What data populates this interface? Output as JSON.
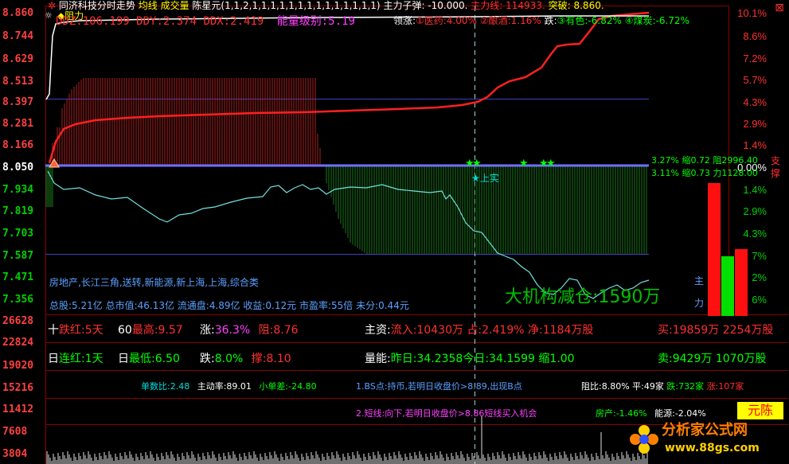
{
  "header": {
    "star": "✲",
    "title": "同济科技分时走势",
    "avg_line": "均线",
    "volume": "成交量",
    "formula": "陈星元(1,1,2,1,1,1,1,1,1,1,1,1,1,1,1,1,1)",
    "main_sub_label": "主力子弹:",
    "main_sub_value": "-10.000.",
    "main_line": "主力线:",
    "main_line_value": "114933.",
    "breakout_label": "突破:",
    "breakout_value": "8.860.",
    "zuli": "阻力",
    "ddz": "DDZ:106.199",
    "ddy": "DDY:2.374",
    "ddx": "DDX:2.419",
    "energy_level": "能量级别:5.19",
    "leading_up_label": "领涨:",
    "leading_up_1": "①医药:4.00%",
    "leading_up_2": "②酿酒:1.16%",
    "leading_down_label": "跌:",
    "leading_down_1": "③有色:-6.82%",
    "leading_down_2": "④煤炭:-6.72%"
  },
  "y_axis": {
    "price_labels": [
      "8.860",
      "8.744",
      "8.629",
      "8.513",
      "8.397",
      "8.281",
      "8.166",
      "8.050",
      "7.934",
      "7.819",
      "7.703",
      "7.587",
      "7.471",
      "7.356"
    ],
    "volume_labels": [
      "26628",
      "22824",
      "19020",
      "15216",
      "11412",
      "7608",
      "3804"
    ]
  },
  "right_axis": {
    "upper": [
      "10.1%",
      "8.6%",
      "7.2%",
      "5.7%",
      "4.3%",
      "2.9%",
      "1.4%"
    ],
    "zero": "0.00%",
    "lower": [
      "1.4%",
      "2.9%",
      "4.3%",
      "7%",
      "2%",
      "6%"
    ]
  },
  "annotations": {
    "buy_top": "3.27% 缩0.72 阻2996.40",
    "buy_bot": "3.11% 缩0.73 力1128.00",
    "shang_shi": "★上实",
    "sector_tags": "房地产,长江三角,送转,新能源,新上海,上海,综合类",
    "stats": "总股:5.21亿  总市值:46.13亿  流通盘:4.89亿  收益:0.12元  市盈率:55倍  未分:0.44元",
    "big_org": "大机构减仓:1590万",
    "side_zhu": "主",
    "side_li": "力",
    "arrow_zhi": "支",
    "arrow_cheng": "撑"
  },
  "info_rows": {
    "r1": {
      "ten": "十",
      "lianhong_label": "跌红:5天",
      "days60": "60",
      "high": "最高:9.57",
      "zhang": "涨:",
      "zhang_val": "36.3%",
      "zu": "阻:8.76",
      "zhuzi": "主资:",
      "liuru": "流入:10430万",
      "zhan": "占:2.419%",
      "jing": "净:1184万股",
      "mai": "买:19859万",
      "mai_gu": "2254万股"
    },
    "r2": {
      "ri": "日",
      "lianhong": "连红:1天",
      "ri2": "日",
      "low": "最低:6.50",
      "die": "跌:",
      "die_val": "8.0%",
      "cheng": "撑:8.10",
      "liangneng": "量能:",
      "zuori": "昨日:34.2358",
      "jinri": "今日:34.1599",
      "suo": "缩1.00",
      "mai2": "卖:9429万",
      "mai2_gu": "1070万股"
    },
    "r3": {
      "danshu": "单数比:2.48",
      "zhudong": "主动率:89.01",
      "xiaodan": "小单差:-24.80",
      "bs": "1.BS点:持币,若明日收盘价>8.89,出现B点",
      "zuli": "阻比:8.80%",
      "ping": "平:49家",
      "die": "跌:732家",
      "zhang": "涨:107家"
    },
    "r4": {
      "duanxian": "2.短线:向下,若明日收盘价>8.86短线买入机会",
      "houchan": "房产:-1.46%",
      "nengyuan": "能源:-2.04%"
    }
  },
  "branding": {
    "chen_tag": "元陈",
    "watermark": "分析家公式网",
    "watermark_url": "www.88gs.com"
  },
  "colors": {
    "price_line": "#ffffff",
    "avg_line": "#ff2020",
    "volume_up": "#ff3030",
    "volume_down": "#00a000",
    "baseline": "#7070ff"
  }
}
